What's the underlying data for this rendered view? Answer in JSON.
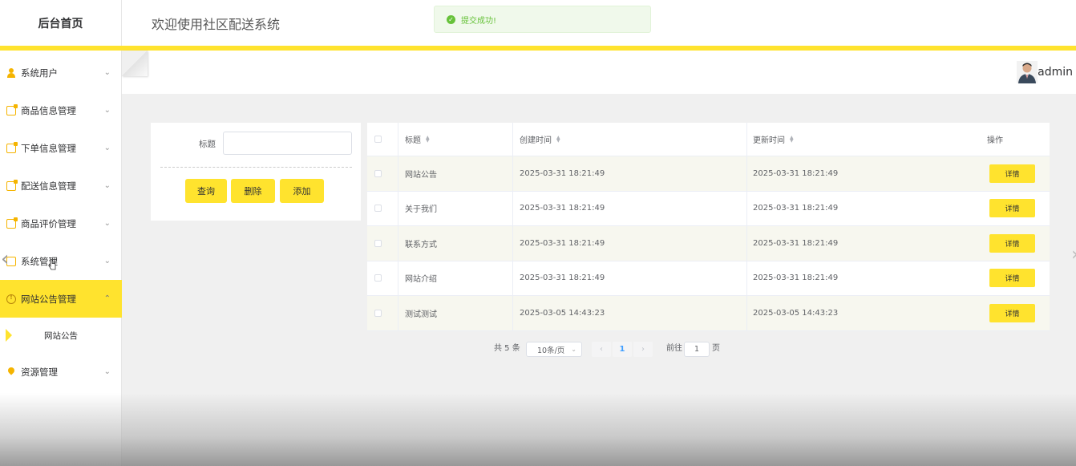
{
  "logo": "后台首页",
  "header": {
    "title": "欢迎使用社区配送系统"
  },
  "toast": {
    "text": "提交成功!"
  },
  "user": {
    "name": "admin"
  },
  "sidebar": {
    "items": [
      {
        "label": "系统用户",
        "icon": "user-icon"
      },
      {
        "label": "商品信息管理",
        "icon": "note-icon"
      },
      {
        "label": "下单信息管理",
        "icon": "note-icon"
      },
      {
        "label": "配送信息管理",
        "icon": "note-icon"
      },
      {
        "label": "商品评价管理",
        "icon": "note-icon"
      },
      {
        "label": "系统管理",
        "icon": "box-icon"
      },
      {
        "label": "网站公告管理",
        "icon": "info-icon",
        "active": true
      },
      {
        "label": "资源管理",
        "icon": "pin-icon"
      }
    ],
    "sub_item": "网站公告"
  },
  "search": {
    "label": "标题",
    "placeholder": "",
    "buttons": {
      "query": "查询",
      "delete": "删除",
      "add": "添加"
    }
  },
  "table": {
    "headers": {
      "title": "标题",
      "created": "创建时间",
      "updated": "更新时间",
      "action": "操作"
    },
    "rows": [
      {
        "title": "网站公告",
        "created": "2025-03-31 18:21:49",
        "updated": "2025-03-31 18:21:49",
        "action": "详情"
      },
      {
        "title": "关于我们",
        "created": "2025-03-31 18:21:49",
        "updated": "2025-03-31 18:21:49",
        "action": "详情"
      },
      {
        "title": "联系方式",
        "created": "2025-03-31 18:21:49",
        "updated": "2025-03-31 18:21:49",
        "action": "详情"
      },
      {
        "title": "网站介绍",
        "created": "2025-03-31 18:21:49",
        "updated": "2025-03-31 18:21:49",
        "action": "详情"
      },
      {
        "title": "测试测试",
        "created": "2025-03-05 14:43:23",
        "updated": "2025-03-05 14:43:23",
        "action": "详情"
      }
    ]
  },
  "pagination": {
    "total": "共 5 条",
    "page_size": "10条/页",
    "current": "1",
    "goto_prefix": "前往",
    "goto_value": "1",
    "goto_suffix": "页"
  },
  "colors": {
    "accent": "#ffe32e",
    "success": "#67c23a"
  }
}
